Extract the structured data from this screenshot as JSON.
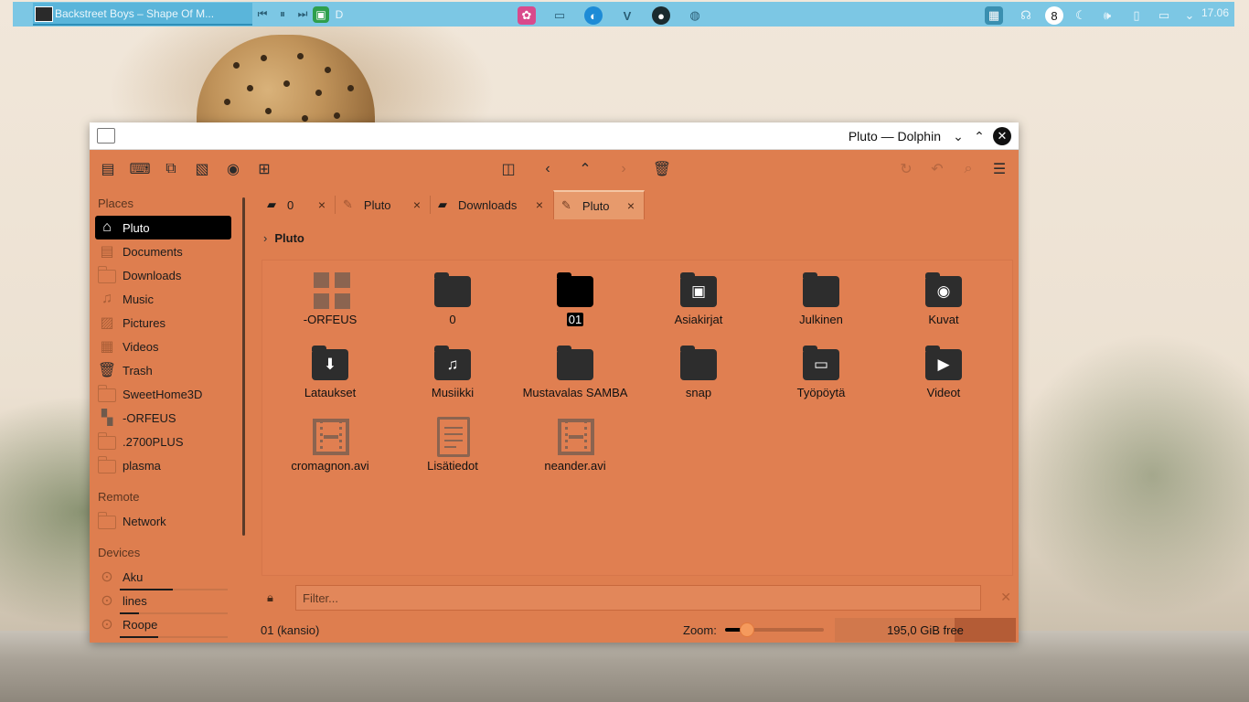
{
  "panel": {
    "task_title": "Backstreet Boys – Shape Of M...",
    "media_prev": "⏮",
    "media_pause": "⏸",
    "media_next": "⏭",
    "battery_text": "D",
    "clock": "17.06"
  },
  "window": {
    "title": "Pluto — Dolphin",
    "min_glyph": "⌄",
    "max_glyph": "⌃",
    "close_glyph": "✕"
  },
  "sidebar": {
    "places_header": "Places",
    "places": [
      {
        "label": "Pluto",
        "icon": "home-icon"
      },
      {
        "label": "Documents",
        "icon": "documents-icon"
      },
      {
        "label": "Downloads",
        "icon": "folder-icon"
      },
      {
        "label": "Music",
        "icon": "music-icon"
      },
      {
        "label": "Pictures",
        "icon": "pictures-icon"
      },
      {
        "label": "Videos",
        "icon": "videos-icon"
      },
      {
        "label": "Trash",
        "icon": "trash-icon"
      },
      {
        "label": "SweetHome3D",
        "icon": "folder-icon"
      },
      {
        "label": "-ORFEUS",
        "icon": "grid-icon"
      },
      {
        "label": ".2700PLUS",
        "icon": "folder-icon"
      },
      {
        "label": "plasma",
        "icon": "folder-icon"
      }
    ],
    "remote_header": "Remote",
    "remote": [
      {
        "label": "Network",
        "icon": "folder-icon"
      }
    ],
    "devices_header": "Devices",
    "devices": [
      {
        "label": "Aku",
        "usage": 0.49
      },
      {
        "label": "lines",
        "usage": 0.18
      },
      {
        "label": "Roope",
        "usage": 0.36
      }
    ]
  },
  "tabs": [
    {
      "label": "0",
      "icon": "folder-icon",
      "active": false
    },
    {
      "label": "Pluto",
      "icon": "edit-icon",
      "active": false
    },
    {
      "label": "Downloads",
      "icon": "folder-icon",
      "active": false
    },
    {
      "label": "Pluto",
      "icon": "edit-icon",
      "active": true
    }
  ],
  "breadcrumb": {
    "chevron": "›",
    "label": "Pluto"
  },
  "files": [
    {
      "name": "-ORFEUS",
      "type": "grid"
    },
    {
      "name": "0",
      "type": "folder"
    },
    {
      "name": "01",
      "type": "folder-selected"
    },
    {
      "name": "Asiakirjat",
      "type": "folder-documents"
    },
    {
      "name": "Julkinen",
      "type": "folder"
    },
    {
      "name": "Kuvat",
      "type": "folder-pictures"
    },
    {
      "name": "Lataukset",
      "type": "folder-downloads"
    },
    {
      "name": "Musiikki",
      "type": "folder-music"
    },
    {
      "name": "Mustavalas SAMBA",
      "type": "folder"
    },
    {
      "name": "snap",
      "type": "folder"
    },
    {
      "name": "Työpöytä",
      "type": "folder-desktop"
    },
    {
      "name": "Videot",
      "type": "folder-videos"
    },
    {
      "name": "cromagnon.avi",
      "type": "video-file"
    },
    {
      "name": "Lisätiedot",
      "type": "text-file"
    },
    {
      "name": "neander.avi",
      "type": "video-file"
    }
  ],
  "filter": {
    "placeholder": "Filter...",
    "value": ""
  },
  "status": {
    "text": "01 (kansio)",
    "zoom_label": "Zoom:",
    "zoom_level": 0.22,
    "free_space": "195,0 GiB free",
    "disk_used": 0.66
  },
  "colors": {
    "accent": "#de7e4f",
    "panel": "#7cc7e4",
    "selection": "#000000"
  }
}
